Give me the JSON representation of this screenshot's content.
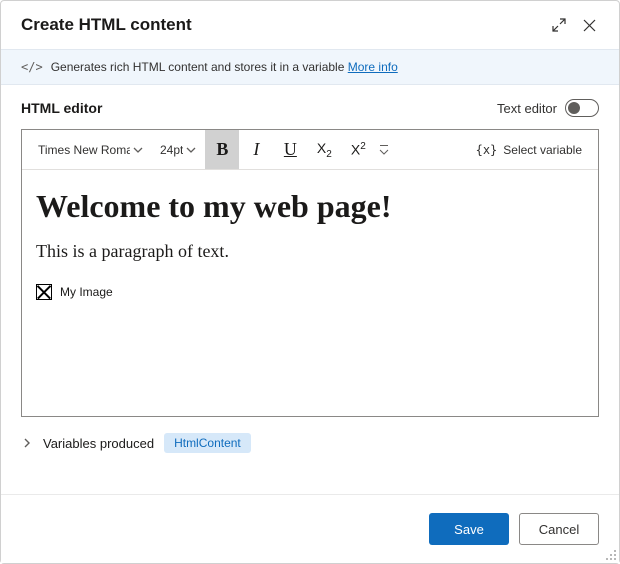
{
  "header": {
    "title": "Create HTML content"
  },
  "info_bar": {
    "text": "Generates rich HTML content and stores it in a variable",
    "more_link": "More info"
  },
  "editor": {
    "label": "HTML editor",
    "text_editor_label": "Text editor",
    "text_editor_on": false,
    "toolbar": {
      "font_family": "Times New Roman",
      "font_size": "24pt",
      "bold_active": true,
      "select_variable": "Select variable"
    },
    "content": {
      "heading": "Welcome to my web page!",
      "paragraph": "This is a paragraph of text.",
      "image_alt": "My Image"
    }
  },
  "variables_produced": {
    "label": "Variables produced",
    "chips": [
      "HtmlContent"
    ]
  },
  "footer": {
    "save": "Save",
    "cancel": "Cancel"
  }
}
